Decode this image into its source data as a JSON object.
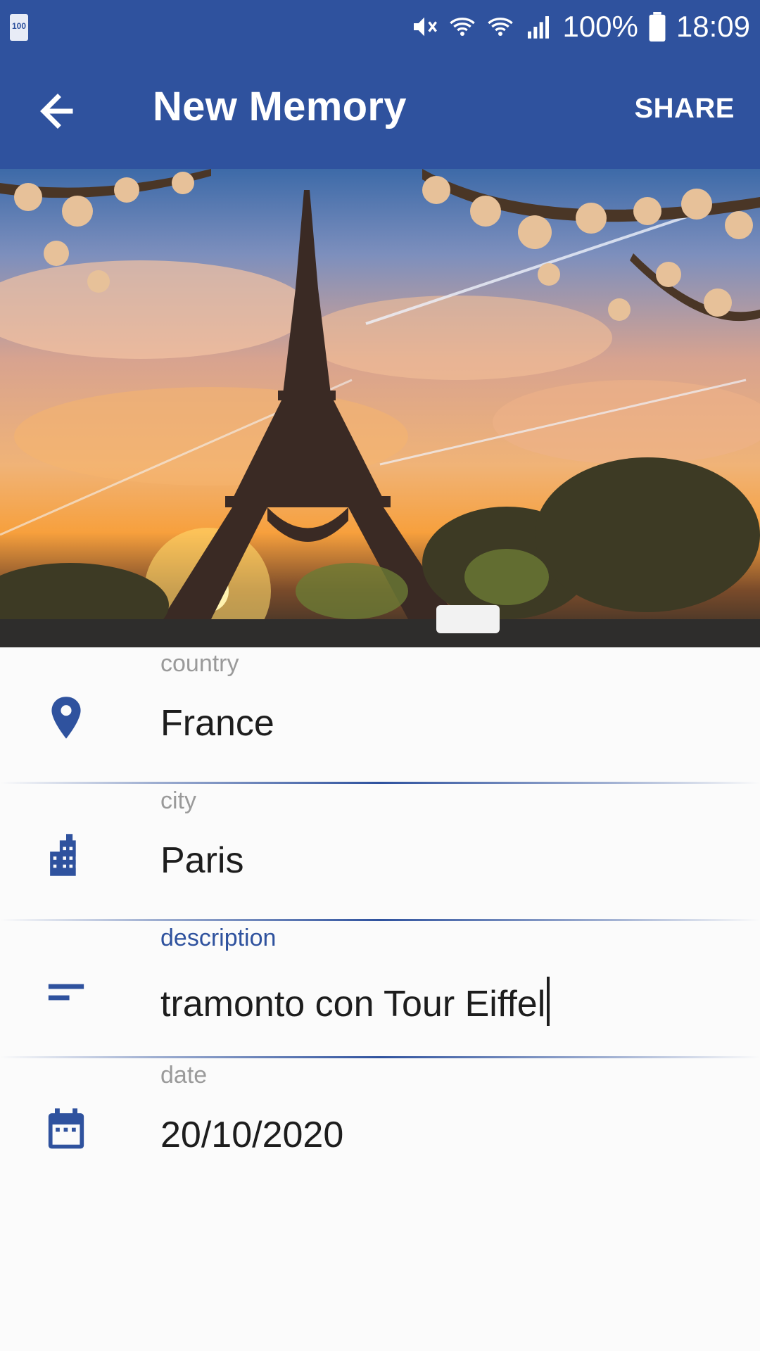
{
  "status_bar": {
    "battery_small": "100",
    "battery_percent": "100%",
    "time": "18:09",
    "icons": [
      "mute-icon",
      "wifi-calling-icon",
      "wifi-icon",
      "signal-icon",
      "battery-icon"
    ]
  },
  "app_bar": {
    "title": "New Memory",
    "share_label": "SHARE",
    "back_icon": "arrow-left-icon"
  },
  "photo": {
    "subject": "eiffel-tower-sunset-photo"
  },
  "form": {
    "country": {
      "label": "country",
      "value": "France",
      "icon": "location-pin-icon"
    },
    "city": {
      "label": "city",
      "value": "Paris",
      "icon": "city-icon"
    },
    "description": {
      "label": "description",
      "value": "tramonto con Tour Eiffel",
      "icon": "short-text-icon"
    },
    "date": {
      "label": "date",
      "value": "20/10/2020",
      "icon": "calendar-icon"
    }
  },
  "colors": {
    "primary": "#2f529e",
    "label_gray": "#9a9a9a",
    "text": "#1d1d1d",
    "background": "#fbfbfb"
  }
}
